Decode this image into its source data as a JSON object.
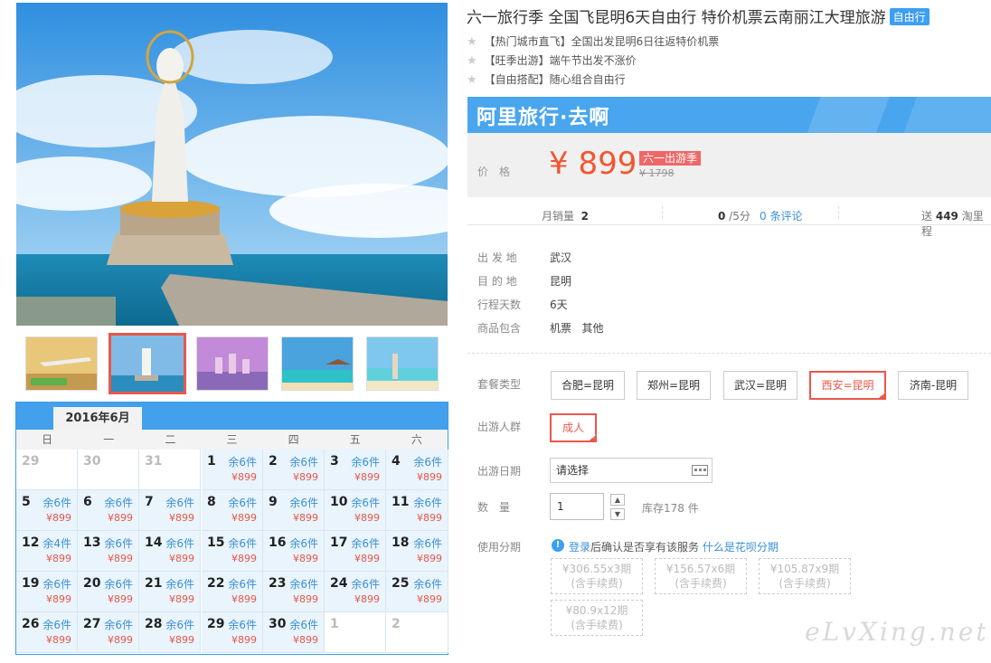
{
  "title": "六一旅行季 全国飞昆明6天自由行 特价机票云南丽江大理旅游",
  "title_tag": "自由行",
  "features": [
    {
      "tag": "【热门城市直飞】",
      "text": "全国出发昆明6日往返特价机票"
    },
    {
      "tag": "【旺季出游】",
      "text": "端午节出发不涨价"
    },
    {
      "tag": "【自由搭配】",
      "text": "随心组合自由行"
    }
  ],
  "banner_logo": "阿里旅行·去啊",
  "price": {
    "label": "价格",
    "current": "¥ 899",
    "promo": "六一出游季",
    "original": "¥ 1798"
  },
  "stats": {
    "sales_label": "月销量",
    "sales_value": "2",
    "rating_value": "0",
    "rating_suffix": " /5分",
    "reviews": "0 条评论",
    "points_prefix": "送",
    "points_value": "449",
    "points_suffix": " 淘里程"
  },
  "info": [
    {
      "k": "出 发 地",
      "v": "武汉"
    },
    {
      "k": "目 的 地",
      "v": "昆明"
    },
    {
      "k": "行程天数",
      "v": "6天"
    },
    {
      "k": "商品包含",
      "v": "机票   其他"
    }
  ],
  "package_label": "套餐类型",
  "packages": [
    {
      "label": "合肥=昆明",
      "selected": false
    },
    {
      "label": "郑州=昆明",
      "selected": false
    },
    {
      "label": "武汉=昆明",
      "selected": false
    },
    {
      "label": "西安=昆明",
      "selected": true
    },
    {
      "label": "济南-昆明",
      "selected": false
    }
  ],
  "crowd_label": "出游人群",
  "crowd_option": "成人",
  "date_label": "出游日期",
  "date_placeholder": "请选择",
  "qty_label": "数　量",
  "qty_value": "1",
  "qty_up": "▲",
  "qty_down": "▼",
  "stock": "库存178 件",
  "installment_label": "使用分期",
  "installment_info_icon": "!",
  "installment_login": "登录",
  "installment_text": "后确认是否享有该服务",
  "installment_link": "什么是花呗分期",
  "installments": [
    {
      "line1": "¥306.55x3期",
      "line2": "(含手续费)"
    },
    {
      "line1": "¥156.57x6期",
      "line2": "(含手续费)"
    },
    {
      "line1": "¥105.87x9期",
      "line2": "(含手续费)"
    },
    {
      "line1": "¥80.9x12期",
      "line2": "(含手续费)"
    }
  ],
  "calendar": {
    "month": "2016年6月",
    "weekdays": [
      "日",
      "一",
      "二",
      "三",
      "四",
      "五",
      "六"
    ],
    "days": [
      {
        "d": "29",
        "inactive": true
      },
      {
        "d": "30",
        "inactive": true
      },
      {
        "d": "31",
        "inactive": true
      },
      {
        "d": "1",
        "stock": "余6件",
        "price": "¥899"
      },
      {
        "d": "2",
        "stock": "余6件",
        "price": "¥899"
      },
      {
        "d": "3",
        "stock": "余6件",
        "price": "¥899"
      },
      {
        "d": "4",
        "stock": "余6件",
        "price": "¥899"
      },
      {
        "d": "5",
        "stock": "余6件",
        "price": "¥899"
      },
      {
        "d": "6",
        "stock": "余6件",
        "price": "¥899"
      },
      {
        "d": "7",
        "stock": "余6件",
        "price": "¥899"
      },
      {
        "d": "8",
        "stock": "余6件",
        "price": "¥899"
      },
      {
        "d": "9",
        "stock": "余6件",
        "price": "¥899"
      },
      {
        "d": "10",
        "stock": "余6件",
        "price": "¥899"
      },
      {
        "d": "11",
        "stock": "余6件",
        "price": "¥899"
      },
      {
        "d": "12",
        "stock": "余4件",
        "price": "¥899"
      },
      {
        "d": "13",
        "stock": "余6件",
        "price": "¥899"
      },
      {
        "d": "14",
        "stock": "余6件",
        "price": "¥899"
      },
      {
        "d": "15",
        "stock": "余6件",
        "price": "¥899"
      },
      {
        "d": "16",
        "stock": "余6件",
        "price": "¥899"
      },
      {
        "d": "17",
        "stock": "余6件",
        "price": "¥899"
      },
      {
        "d": "18",
        "stock": "余6件",
        "price": "¥899"
      },
      {
        "d": "19",
        "stock": "余6件",
        "price": "¥899"
      },
      {
        "d": "20",
        "stock": "余6件",
        "price": "¥899"
      },
      {
        "d": "21",
        "stock": "余6件",
        "price": "¥899"
      },
      {
        "d": "22",
        "stock": "余6件",
        "price": "¥899"
      },
      {
        "d": "23",
        "stock": "余6件",
        "price": "¥899"
      },
      {
        "d": "24",
        "stock": "余6件",
        "price": "¥899"
      },
      {
        "d": "25",
        "stock": "余6件",
        "price": "¥899"
      },
      {
        "d": "26",
        "stock": "余6件",
        "price": "¥899"
      },
      {
        "d": "27",
        "stock": "余6件",
        "price": "¥899"
      },
      {
        "d": "28",
        "stock": "余6件",
        "price": "¥899"
      },
      {
        "d": "29",
        "stock": "余6件",
        "price": "¥899"
      },
      {
        "d": "30",
        "stock": "余6件",
        "price": "¥899"
      },
      {
        "d": "1",
        "inactive": true
      },
      {
        "d": "2",
        "inactive": true
      }
    ]
  },
  "watermark": "eLvXing.net"
}
